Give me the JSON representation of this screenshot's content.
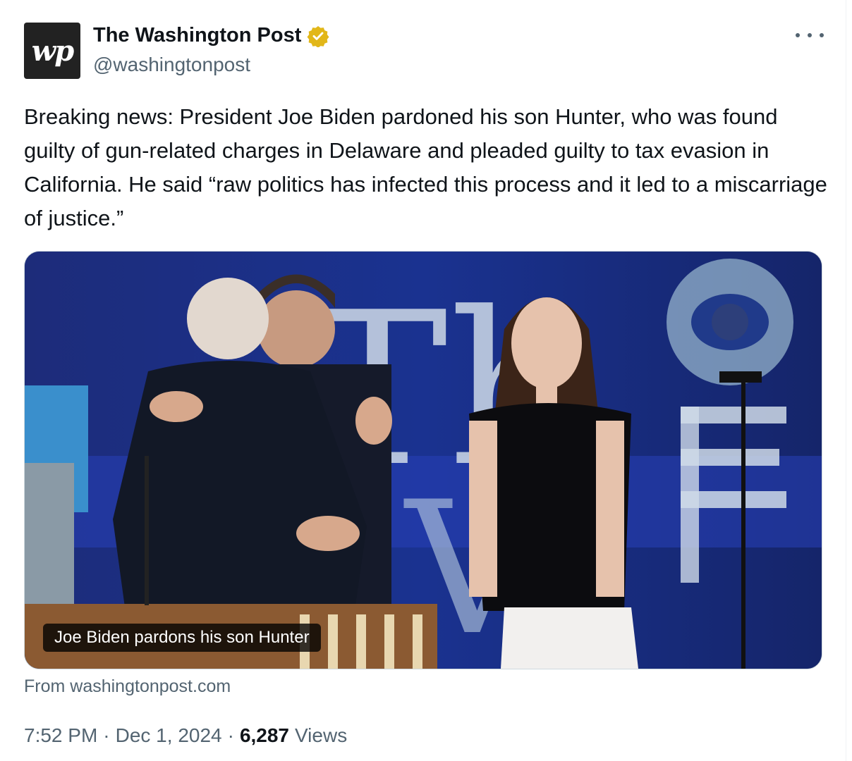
{
  "account": {
    "avatar_text": "wp",
    "display_name": "The Washington Post",
    "handle": "@washingtonpost",
    "verified_color": "#e2b719"
  },
  "tweet": {
    "text": "Breaking news: President Joe Biden pardoned his son Hunter, who was found guilty of gun-related charges in Delaware and pleaded guilty to tax evasion in California. He said “raw politics has infected this process and it led to a miscarriage of justice.”"
  },
  "card": {
    "caption": "Joe Biden pardons his son Hunter",
    "source": "From washingtonpost.com"
  },
  "meta": {
    "time": "7:52 PM",
    "separator": "·",
    "date": "Dec 1, 2024",
    "views_count": "6,287",
    "views_label": "Views"
  },
  "icons": {
    "more": "more-horizontal-icon",
    "verified": "verified-badge-icon"
  }
}
